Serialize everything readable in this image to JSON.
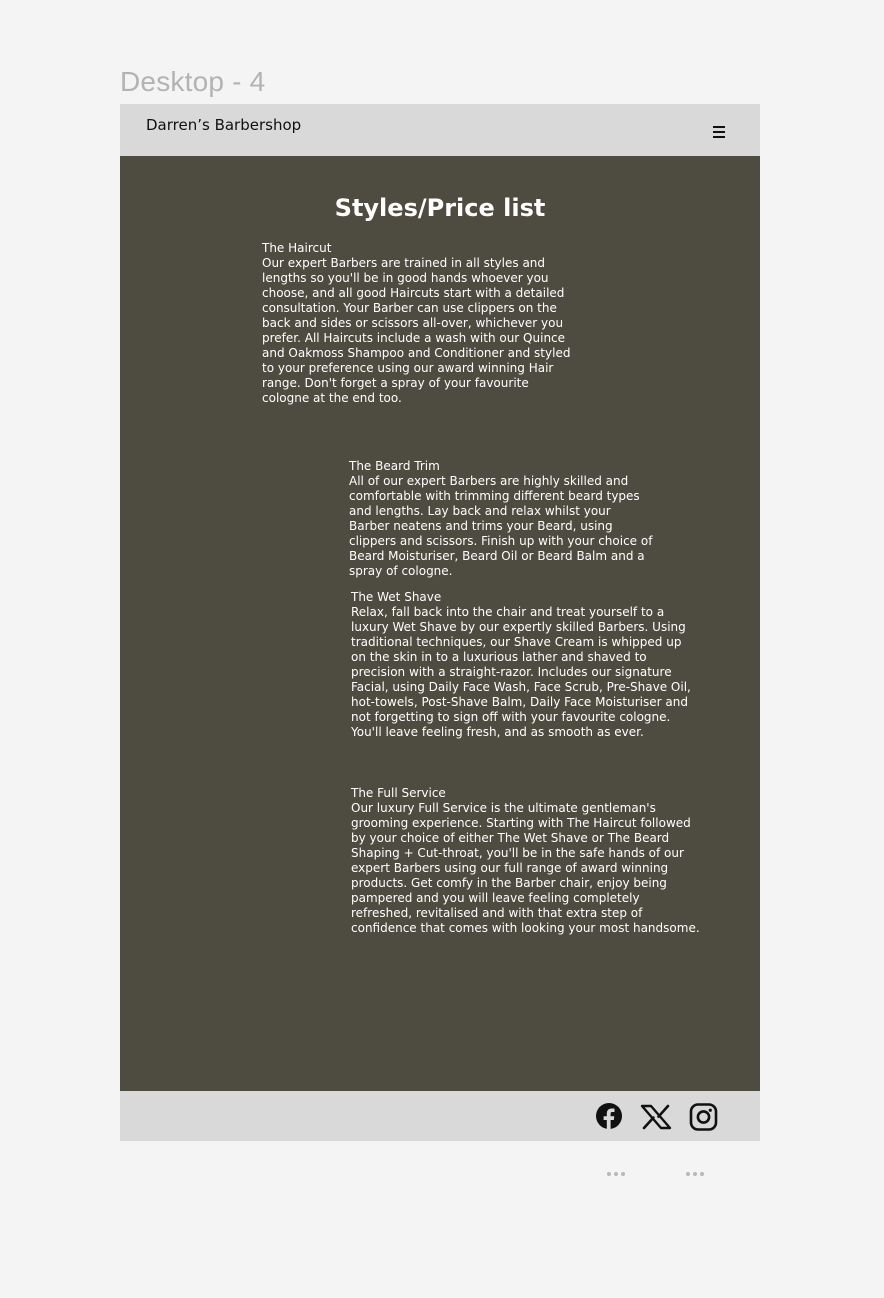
{
  "canvas": {
    "frame_label": "Desktop - 4"
  },
  "header": {
    "brand": "Darren’s Barbershop",
    "menu_icon": "hamburger-menu-icon"
  },
  "main": {
    "title": "Styles/Price list",
    "services": [
      {
        "title": "The Haircut",
        "description": "Our expert Barbers are trained in all styles and lengths so you'll be in good hands whoever you choose, and all good Haircuts start with a detailed consultation. Your Barber can use clippers on the back and sides or scissors all-over, whichever you prefer. All Haircuts include a wash with our Quince and Oakmoss Shampoo and Conditioner and styled to your preference using our award winning Hair range. Don't forget a spray of your favourite cologne at the end too."
      },
      {
        "title": "The Beard Trim",
        "description": "All of our expert Barbers are highly skilled and comfortable with trimming different beard types and lengths. Lay back and relax whilst your Barber neatens and trims your Beard, using clippers and scissors. Finish up with your choice of Beard Moisturiser, Beard Oil or Beard Balm and a spray of cologne."
      },
      {
        "title": "The Wet Shave",
        "description": "Relax, fall back into the chair and treat yourself to a luxury Wet Shave by our expertly skilled Barbers. Using traditional techniques, our Shave Cream is whipped up on the skin in to a luxurious lather and shaved to precision with a straight-razor. Includes our signature Facial, using Daily Face Wash, Face Scrub, Pre-Shave Oil, hot-towels, Post-Shave Balm, Daily Face Moisturiser and not forgetting to sign off with your favourite cologne. You'll leave feeling fresh, and as smooth as ever."
      },
      {
        "title": "The Full Service",
        "description": "Our luxury Full Service is the ultimate gentleman's grooming experience. Starting with The Haircut followed by your choice of either The Wet Shave or The Beard Shaping + Cut-throat, you'll be in the safe hands of our expert Barbers using our full range of award winning products. Get comfy in the Barber chair, enjoy being pampered and you will leave feeling completely refreshed, revitalised and with that extra step of confidence that comes with looking your most handsome."
      }
    ]
  },
  "footer": {
    "social_icons": [
      "facebook-icon",
      "x-twitter-icon",
      "instagram-icon"
    ]
  },
  "colors": {
    "background": "#f4f4f4",
    "frame": "#4e4b40",
    "bars": "#d9d9d9",
    "text_light": "#ffffff",
    "text_dark": "#111111"
  }
}
